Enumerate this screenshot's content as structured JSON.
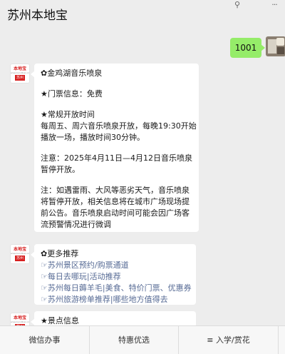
{
  "header": {
    "title": "苏州本地宝",
    "pin_icon": "pin-icon",
    "more_icon": "more-icon"
  },
  "messages": {
    "outgoing": {
      "text": "1001"
    },
    "bot_avatar": {
      "brand": "本地宝",
      "sub": "www.bendibao.com",
      "tag": "苏州"
    },
    "m1": {
      "lines": [
        "✿金鸡湖音乐喷泉",
        "",
        "★门票信息：免费",
        "",
        "★常规开放时间",
        "每周五、周六音乐喷泉开放，每晚19:30开始",
        "播放一场，播放时间30分钟。",
        "",
        "注意：2025年4月11日—4月12日音乐喷泉",
        "暂停开放。",
        "",
        "注：如遇雷雨、大风等恶劣天气，音乐喷泉",
        "将暂停开放，相关信息将在城市广场现场提",
        "前公告。音乐喷泉启动时间可能会因广场客",
        "流预警情况进行微调"
      ]
    },
    "m2": {
      "title": "✿更多推荐",
      "links": [
        "☞苏州景区预约/购票通道",
        "☞每日去哪玩|活动推荐",
        "☞苏州每日薅羊毛|美食、特价门票、优惠券",
        "☞苏州旅游榜单推荐|哪些地方值得去"
      ]
    },
    "m3": {
      "title": "★景点信息"
    }
  },
  "menu": {
    "items": [
      "微信办事",
      "特惠优选",
      "≡ 入学/赏花"
    ]
  },
  "colors": {
    "background": "#ededed",
    "outgoing_bubble": "#95ec69",
    "link": "#576b95",
    "brand_red": "#d71f1f"
  }
}
